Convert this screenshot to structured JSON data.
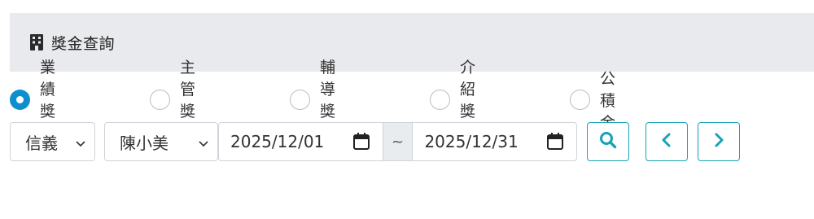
{
  "header": {
    "title": "獎金查詢",
    "icon": "building-icon"
  },
  "bonus_types": [
    {
      "label": "業績獎金",
      "checked": true
    },
    {
      "label": "主管獎金",
      "checked": false
    },
    {
      "label": "輔導獎金",
      "checked": false
    },
    {
      "label": "介紹獎金",
      "checked": false
    },
    {
      "label": "公積金",
      "checked": false
    }
  ],
  "filters": {
    "branch": "信義",
    "person": "陳小美",
    "date_start": "2025/12/01",
    "date_separator": "~",
    "date_end": "2025/12/31"
  },
  "buttons": {
    "search_icon": "search-icon",
    "prev_icon": "chevron-left-icon",
    "next_icon": "chevron-right-icon"
  },
  "colors": {
    "accent": "#17a2b8",
    "radio_checked": "#0d8fcd",
    "header_bg": "#e8eaed"
  }
}
